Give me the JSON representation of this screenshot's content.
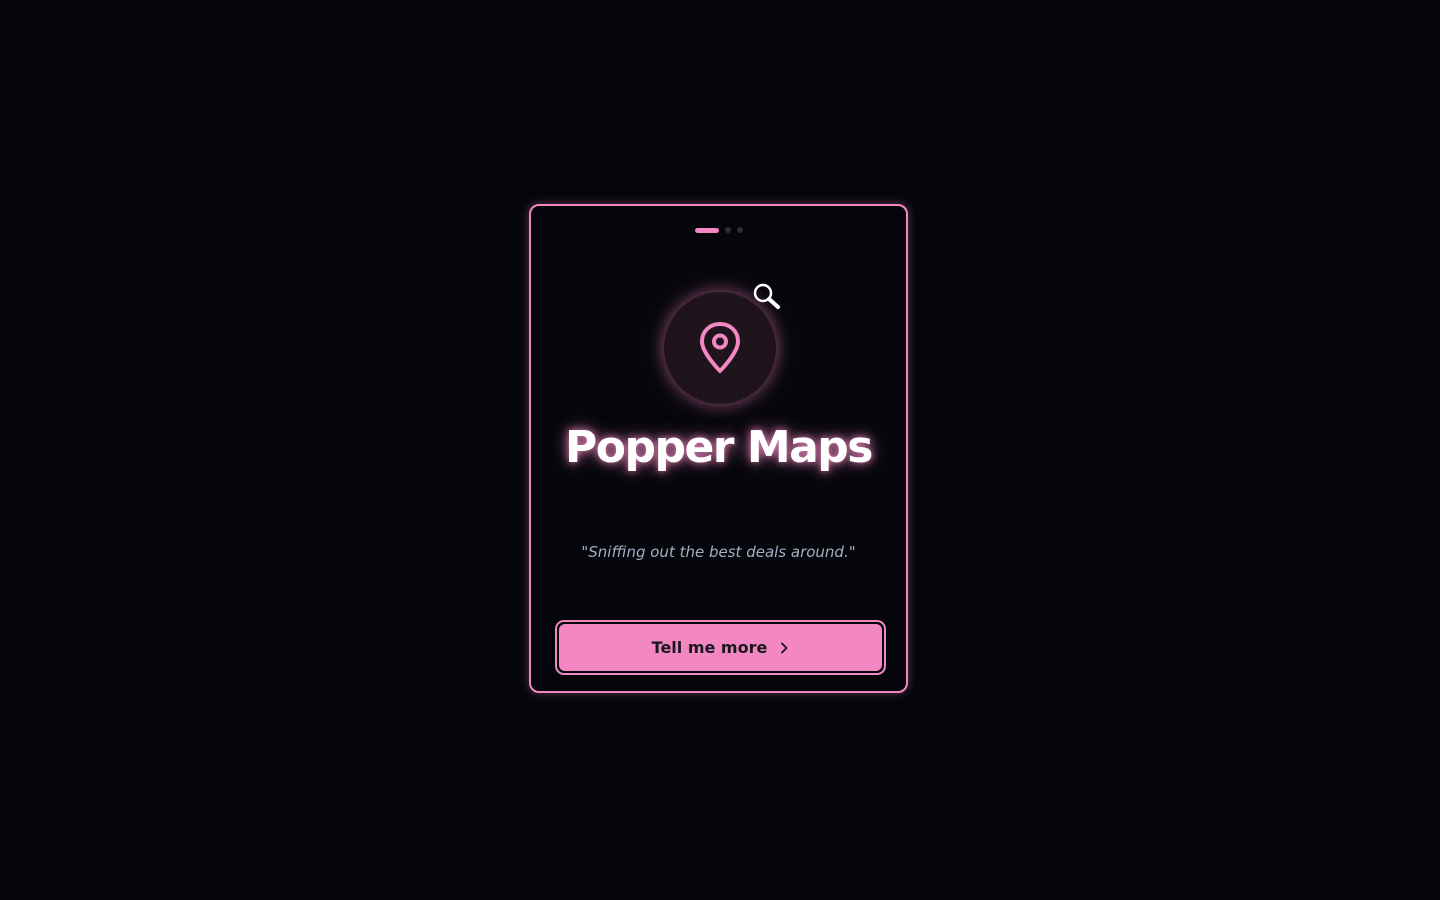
{
  "app": {
    "title": "Popper Maps",
    "tagline": "\"Sniffing out the best deals around.\""
  },
  "pagination": {
    "total": 3,
    "current": 1
  },
  "icons": {
    "main": "map-pin-icon",
    "badge": "magnifier-icon",
    "cta": "chevron-right-icon"
  },
  "cta": {
    "label": "Tell me more"
  },
  "colors": {
    "accent": "#f287c1",
    "background": "#05060b",
    "circle": "#1f141b",
    "tagline": "#a6adc0",
    "inactive_dot": "#2c2d35"
  }
}
